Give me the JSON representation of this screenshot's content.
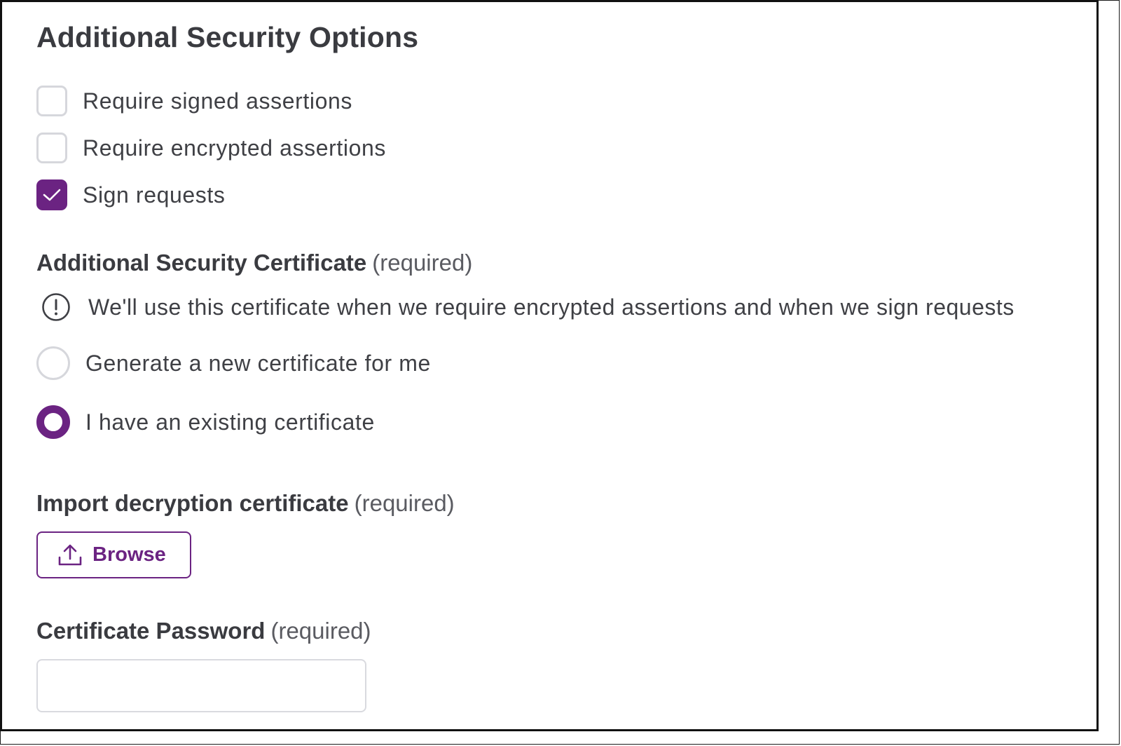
{
  "section": {
    "title": "Additional Security Options"
  },
  "options": {
    "require_signed": {
      "label": "Require signed assertions",
      "checked": false
    },
    "require_encrypted": {
      "label": "Require encrypted assertions",
      "checked": false
    },
    "sign_requests": {
      "label": "Sign requests",
      "checked": true
    }
  },
  "certificate": {
    "label": "Additional Security Certificate",
    "required": "(required)",
    "info_icon": "exclamation-circle-icon",
    "info": "We'll use this certificate when we require encrypted assertions and when we sign requests",
    "choices": {
      "generate": {
        "label": "Generate a new certificate for me",
        "selected": false
      },
      "existing": {
        "label": "I have an existing certificate",
        "selected": true
      }
    }
  },
  "import": {
    "label": "Import decryption certificate",
    "required": "(required)",
    "browse_icon": "upload-icon",
    "browse_label": "Browse"
  },
  "password": {
    "label": "Certificate Password",
    "required": "(required)",
    "value": "",
    "placeholder": ""
  },
  "colors": {
    "accent": "#6b2382",
    "text": "#3f4045",
    "border": "#d6d7dc"
  }
}
